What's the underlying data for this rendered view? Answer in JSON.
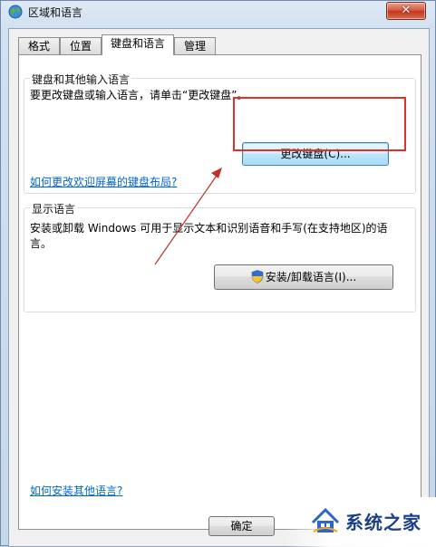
{
  "window": {
    "title": "区域和语言",
    "close_label": "✕"
  },
  "tabs": [
    {
      "label": "格式",
      "active": false
    },
    {
      "label": "位置",
      "active": false
    },
    {
      "label": "键盘和语言",
      "active": true
    },
    {
      "label": "管理",
      "active": false
    }
  ],
  "keyboard_group": {
    "title": "键盘和其他输入语言",
    "description": "要更改键盘或输入语言，请单击“更改键盘”。",
    "change_keyboard_button": "更改键盘(C)...",
    "welcome_link": "如何更改欢迎屏幕的键盘布局?"
  },
  "display_group": {
    "title": "显示语言",
    "description_line1": "安装或卸载 Windows 可用于显示文本和识别语音和手写(在支持地区)的语",
    "description_line2": "言。",
    "install_button": "安装/卸载语言(I)..."
  },
  "bottom_link": "如何安装其他语言?",
  "footer": {
    "ok_button": "确定"
  },
  "watermark": {
    "text": "系统之家"
  },
  "colors": {
    "highlight": "#e0302b",
    "link": "#0066cc"
  }
}
